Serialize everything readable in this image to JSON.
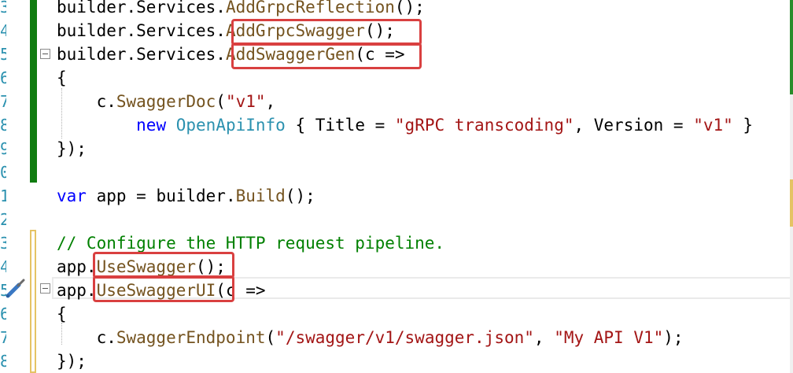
{
  "editor": {
    "line_numbers": [
      "3",
      "4",
      "5",
      "6",
      "7",
      "8",
      "9",
      "0",
      "1",
      "2",
      "3",
      "4",
      "5",
      "6",
      "7",
      "8"
    ],
    "lines": [
      {
        "tokens": [
          {
            "text": "builder.Services.",
            "kind": "default"
          },
          {
            "text": "AddGrpcReflection",
            "kind": "method"
          },
          {
            "text": "();",
            "kind": "default"
          }
        ]
      },
      {
        "tokens": [
          {
            "text": "builder.Services.",
            "kind": "default"
          },
          {
            "text": "AddGrpcSwagger",
            "kind": "method"
          },
          {
            "text": "();",
            "kind": "default"
          }
        ]
      },
      {
        "tokens": [
          {
            "text": "builder.Services.",
            "kind": "default"
          },
          {
            "text": "AddSwaggerGen",
            "kind": "method"
          },
          {
            "text": "(c =>",
            "kind": "default"
          }
        ]
      },
      {
        "tokens": [
          {
            "text": "{",
            "kind": "default"
          }
        ]
      },
      {
        "tokens": [
          {
            "text": "    c.",
            "kind": "default"
          },
          {
            "text": "SwaggerDoc",
            "kind": "method"
          },
          {
            "text": "(",
            "kind": "default"
          },
          {
            "text": "\"v1\"",
            "kind": "string"
          },
          {
            "text": ",",
            "kind": "default"
          }
        ]
      },
      {
        "tokens": [
          {
            "text": "        ",
            "kind": "default"
          },
          {
            "text": "new",
            "kind": "keyword"
          },
          {
            "text": " ",
            "kind": "default"
          },
          {
            "text": "OpenApiInfo",
            "kind": "type"
          },
          {
            "text": " { Title = ",
            "kind": "default"
          },
          {
            "text": "\"gRPC transcoding\"",
            "kind": "string"
          },
          {
            "text": ", Version = ",
            "kind": "default"
          },
          {
            "text": "\"v1\"",
            "kind": "string"
          },
          {
            "text": " }",
            "kind": "default"
          }
        ]
      },
      {
        "tokens": [
          {
            "text": "});",
            "kind": "default"
          }
        ]
      },
      {
        "tokens": []
      },
      {
        "tokens": [
          {
            "text": "var",
            "kind": "keyword"
          },
          {
            "text": " app = builder.",
            "kind": "default"
          },
          {
            "text": "Build",
            "kind": "method"
          },
          {
            "text": "();",
            "kind": "default"
          }
        ]
      },
      {
        "tokens": []
      },
      {
        "tokens": [
          {
            "text": "// Configure the HTTP request pipeline.",
            "kind": "comment"
          }
        ]
      },
      {
        "tokens": [
          {
            "text": "app.",
            "kind": "default"
          },
          {
            "text": "UseSwagger",
            "kind": "method"
          },
          {
            "text": "();",
            "kind": "default"
          }
        ]
      },
      {
        "tokens": [
          {
            "text": "app.",
            "kind": "default"
          },
          {
            "text": "UseSwaggerUI",
            "kind": "method"
          },
          {
            "text": "(c =>",
            "kind": "default"
          }
        ]
      },
      {
        "tokens": [
          {
            "text": "{",
            "kind": "default"
          }
        ]
      },
      {
        "tokens": [
          {
            "text": "    c.",
            "kind": "default"
          },
          {
            "text": "SwaggerEndpoint",
            "kind": "method"
          },
          {
            "text": "(",
            "kind": "default"
          },
          {
            "text": "\"/swagger/v1/swagger.json\"",
            "kind": "string"
          },
          {
            "text": ", ",
            "kind": "default"
          },
          {
            "text": "\"My API V1\"",
            "kind": "string"
          },
          {
            "text": ");",
            "kind": "default"
          }
        ]
      },
      {
        "tokens": [
          {
            "text": "});",
            "kind": "default"
          }
        ]
      }
    ]
  },
  "colors": {
    "highlight": "#d94040",
    "change_saved": "#107c10",
    "change_unsaved": "#e5c365",
    "method": "#74531f",
    "string": "#a31515",
    "keyword": "#0000ff",
    "type": "#2b91af",
    "comment": "#008000"
  },
  "icons": {
    "collapse": "collapse-minus-icon",
    "quick_action": "screwdriver-lightbulb-icon"
  }
}
